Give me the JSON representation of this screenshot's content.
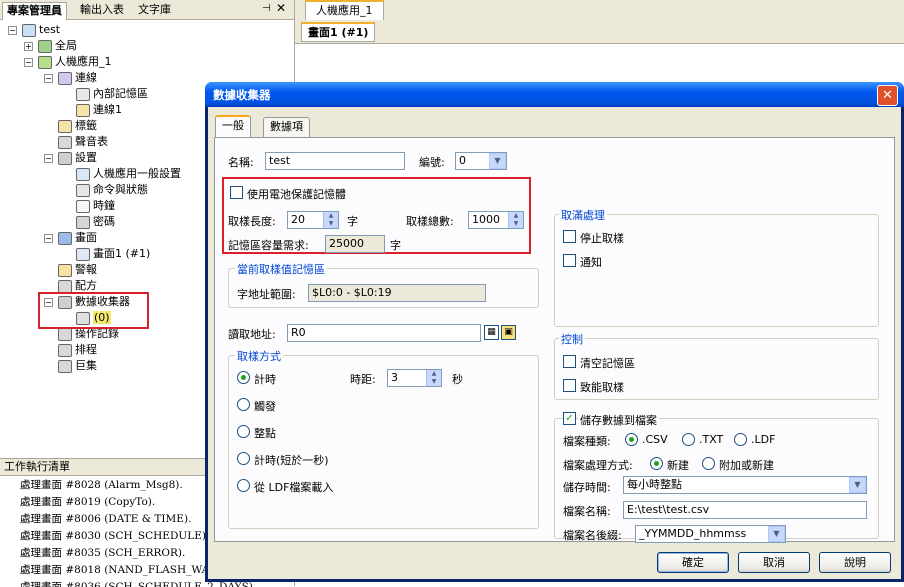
{
  "left_panel": {
    "tabs": [
      "專案管理員",
      "輸出入表",
      "文字庫"
    ],
    "pin_icon": "pin-icon",
    "close_icon": "close-icon",
    "tree": [
      {
        "label": "test",
        "icon": "project-icon",
        "level": 0,
        "expand": "minus"
      },
      {
        "label": "全局",
        "icon": "globe-icon",
        "level": 1,
        "expand": "plus"
      },
      {
        "label": "人機應用_1",
        "icon": "hmi-icon",
        "level": 1,
        "expand": "minus"
      },
      {
        "label": "連線",
        "icon": "connection-icon",
        "level": 2,
        "expand": "minus"
      },
      {
        "label": "內部記憶區",
        "icon": "memory-icon",
        "level": 3,
        "expand": ""
      },
      {
        "label": "連線1",
        "icon": "link-icon",
        "level": 3,
        "expand": ""
      },
      {
        "label": "標籤",
        "icon": "tag-icon",
        "level": 2,
        "expand": ""
      },
      {
        "label": "聲音表",
        "icon": "sound-icon",
        "level": 2,
        "expand": ""
      },
      {
        "label": "設置",
        "icon": "settings-icon",
        "level": 2,
        "expand": "minus"
      },
      {
        "label": "人機應用一般設置",
        "icon": "general-settings-icon",
        "level": 3,
        "expand": ""
      },
      {
        "label": "命令與狀態",
        "icon": "command-status-icon",
        "level": 3,
        "expand": ""
      },
      {
        "label": "時鐘",
        "icon": "clock-icon",
        "level": 3,
        "expand": ""
      },
      {
        "label": "密碼",
        "icon": "password-icon",
        "level": 3,
        "expand": ""
      },
      {
        "label": "畫面",
        "icon": "screens-icon",
        "level": 2,
        "expand": "minus"
      },
      {
        "label": "畫面1 (#1)",
        "icon": "screen-icon",
        "level": 3,
        "expand": ""
      },
      {
        "label": "警報",
        "icon": "alarm-icon",
        "level": 2,
        "expand": ""
      },
      {
        "label": "配方",
        "icon": "recipe-icon",
        "level": 2,
        "expand": ""
      },
      {
        "label": "數據收集器",
        "icon": "data-logger-icon",
        "level": 2,
        "expand": "minus"
      },
      {
        "label": "(0)",
        "icon": "logger-item-icon",
        "level": 3,
        "expand": ""
      },
      {
        "label": "操作記錄",
        "icon": "operation-log-icon",
        "level": 2,
        "expand": ""
      },
      {
        "label": "排程",
        "icon": "schedule-icon",
        "level": 2,
        "expand": ""
      },
      {
        "label": "巨集",
        "icon": "macro-icon",
        "level": 2,
        "expand": ""
      }
    ],
    "tasks_title": "工作執行清單",
    "tasks": [
      "處理畫面 #8028 (Alarm_Msg8).",
      "處理畫面 #8019 (CopyTo).",
      "處理畫面 #8006 (DATE & TIME).",
      "處理畫面 #8030 (SCH_SCHEDULE).",
      "處理畫面 #8035 (SCH_ERROR).",
      "處理畫面 #8018 (NAND_FLASH_WA",
      "處理畫面 #8036 (SCH_SCHEDULE_2_DAYS)"
    ]
  },
  "right_panel": {
    "tab": "人機應用_1",
    "subtab": "畫面1 (#1)"
  },
  "dialog": {
    "title": "數據收集器",
    "tabs": [
      "一般",
      "數據項"
    ],
    "name_label": "名稱:",
    "name_value": "test",
    "number_label": "編號:",
    "number_value": "0",
    "battery_label": "使用電池保護記憶體",
    "battery_checked": false,
    "sample_length_label": "取樣長度:",
    "sample_length_value": "20",
    "sample_length_unit": "字",
    "sample_total_label": "取樣總數:",
    "sample_total_value": "1000",
    "memory_req_label": "記憶區容量需求:",
    "memory_req_value": "25000",
    "memory_req_unit": "字",
    "current_group": "當前取樣值記憶區",
    "addr_range_label": "字地址範圍:",
    "addr_range_value": "$L0:0 - $L0:19",
    "read_addr_label": "讀取地址:",
    "read_addr_value": "R0",
    "sample_group": "取樣方式",
    "sample_options": [
      "計時",
      "觸發",
      "整點",
      "計時(短於一秒)",
      "從 LDF檔案載入"
    ],
    "sample_selected": 0,
    "interval_label": "時距:",
    "interval_value": "3",
    "interval_unit": "秒",
    "full_group": "取滿處理",
    "full_options": [
      "停止取樣",
      "通知"
    ],
    "control_group": "控制",
    "control_options": [
      "清空記憶區",
      "致能取樣"
    ],
    "save_label": "儲存數據到檔案",
    "save_checked": true,
    "file_type_label": "檔案種類:",
    "file_types": [
      ".CSV",
      ".TXT",
      ".LDF"
    ],
    "file_type_selected": 0,
    "file_mode_label": "檔案處理方式:",
    "file_modes": [
      "新建",
      "附加或新建"
    ],
    "file_mode_selected": 0,
    "save_time_label": "儲存時間:",
    "save_time_value": "每小時整點",
    "file_name_label": "檔案名稱:",
    "file_name_value": "E:\\test\\test.csv",
    "file_suffix_label": "檔案名後綴:",
    "file_suffix_value": "_YYMMDD_hhmmss",
    "ok_label": "確定",
    "cancel_label": "取消",
    "help_label": "說明"
  },
  "colors": {
    "highlight_border": "#d8212a",
    "title_bar": "#0054e3",
    "group_title": "#0046d5"
  }
}
